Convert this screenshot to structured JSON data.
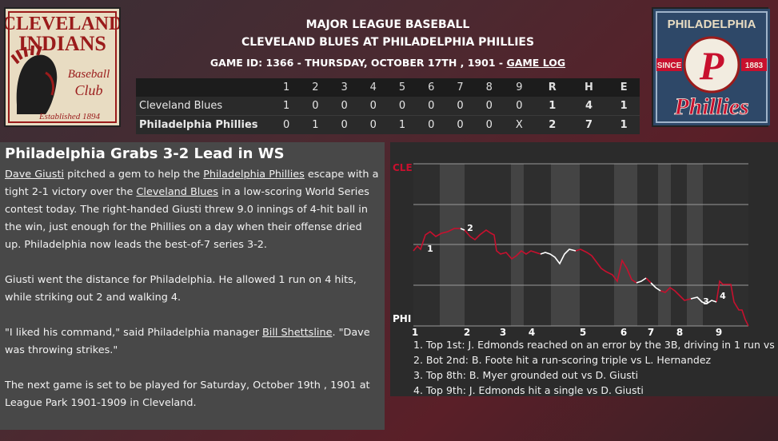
{
  "header": {
    "league": "MAJOR LEAGUE BASEBALL",
    "matchup": "CLEVELAND BLUES AT PHILADELPHIA PHILLIES",
    "game_info": "GAME ID: 1366 - THURSDAY, OCTOBER 17TH , 1901 - ",
    "game_log_link": "GAME LOG"
  },
  "logos": {
    "away": {
      "line1": "CLEVELAND",
      "line2": "INDIANS",
      "script1": "Baseball",
      "script2": "Club",
      "footer": "Established 1894"
    },
    "home": {
      "top": "PHILADELPHIA",
      "letter": "P",
      "since": "SINCE",
      "year": "1883",
      "script": "Phillies"
    }
  },
  "linescore": {
    "headers": [
      "1",
      "2",
      "3",
      "4",
      "5",
      "6",
      "7",
      "8",
      "9",
      "R",
      "H",
      "E"
    ],
    "rows": [
      {
        "team": "Cleveland Blues",
        "cells": [
          "1",
          "0",
          "0",
          "0",
          "0",
          "0",
          "0",
          "0",
          "0",
          "1",
          "4",
          "1"
        ]
      },
      {
        "team": "Philadelphia Phillies",
        "cells": [
          "0",
          "1",
          "0",
          "0",
          "1",
          "0",
          "0",
          "0",
          "X",
          "2",
          "7",
          "1"
        ]
      }
    ]
  },
  "story": {
    "headline": "Philadelphia Grabs 3-2 Lead in WS",
    "p1": {
      "link1": "Dave Giusti",
      "t1": " pitched a gem to help the ",
      "link2": "Philadelphia Phillies",
      "t2": " escape with a tight 2-1 victory over the ",
      "link3": "Cleveland Blues",
      "t3": " in a low-scoring World Series contest today. The right-handed Giusti threw 9.0 innings of 4-hit ball in the win, just enough for the Phillies on a day when their offense dried up. Philadelphia now leads the best-of-7 series 3-2."
    },
    "p2": "Giusti went the distance for Philadelphia. He allowed 1 run on 4 hits, while striking out 2 and walking 4.",
    "p3": {
      "t1": "\"I liked his command,\" said Philadelphia manager ",
      "link": "Bill Shettsline",
      "t2": ". \"Dave was throwing strikes.\""
    },
    "p4": "The next game is set to be played for Saturday, October 19th , 1901 at League Park 1901-1909 in Cleveland."
  },
  "win_probability": {
    "away_label": "CLE",
    "home_label": "PHI",
    "innings": [
      "1",
      "2",
      "3",
      "4",
      "5",
      "6",
      "7",
      "8",
      "9"
    ],
    "marker_labels": [
      "1",
      "2",
      "3",
      "4"
    ],
    "notes": [
      "1. Top 1st: J. Edmonds reached on an error by the 3B, driving in 1 run vs D",
      "2. Bot 2nd: B. Foote hit a run-scoring triple vs L. Hernandez",
      "3. Top 8th: B. Myer grounded out vs D. Giusti",
      "4. Top 9th: J. Edmonds hit a single vs D. Giusti"
    ],
    "colors": {
      "away": "#c8102e",
      "home": "#ffffff",
      "shade": "#444444",
      "band": "#2e2e2e"
    }
  }
}
